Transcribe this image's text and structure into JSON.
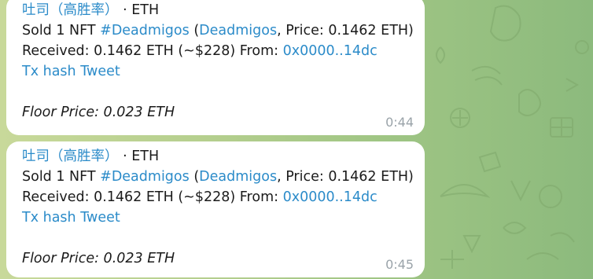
{
  "messages": [
    {
      "author": "吐司（高胜率）",
      "chain_label": "· ETH",
      "sold_prefix": "Sold 1 NFT ",
      "hashtag": "#Deadmigos",
      "open_paren": " (",
      "collection_link": "Deadmigos",
      "price_text": ", Price: 0.1462 ETH)",
      "received_text": "Received: 0.1462 ETH (~$228) From: ",
      "from_address": "0x0000..14dc",
      "tx_hash_link": "Tx hash",
      "tweet_link": "Tweet",
      "floor_text": "Floor Price: 0.023 ETH",
      "time": "0:44"
    },
    {
      "author": "吐司（高胜率）",
      "chain_label": "· ETH",
      "sold_prefix": "Sold 1 NFT ",
      "hashtag": "#Deadmigos",
      "open_paren": " (",
      "collection_link": "Deadmigos",
      "price_text": ", Price: 0.1462 ETH)",
      "received_text": "Received: 0.1462 ETH (~$228) From: ",
      "from_address": "0x0000..14dc",
      "tx_hash_link": "Tx hash",
      "tweet_link": "Tweet",
      "floor_text": "Floor Price: 0.023 ETH",
      "time": "0:45"
    }
  ],
  "colors": {
    "link": "#2b8bc9",
    "timestamp": "#9aa3a9",
    "bubble": "#ffffff"
  }
}
